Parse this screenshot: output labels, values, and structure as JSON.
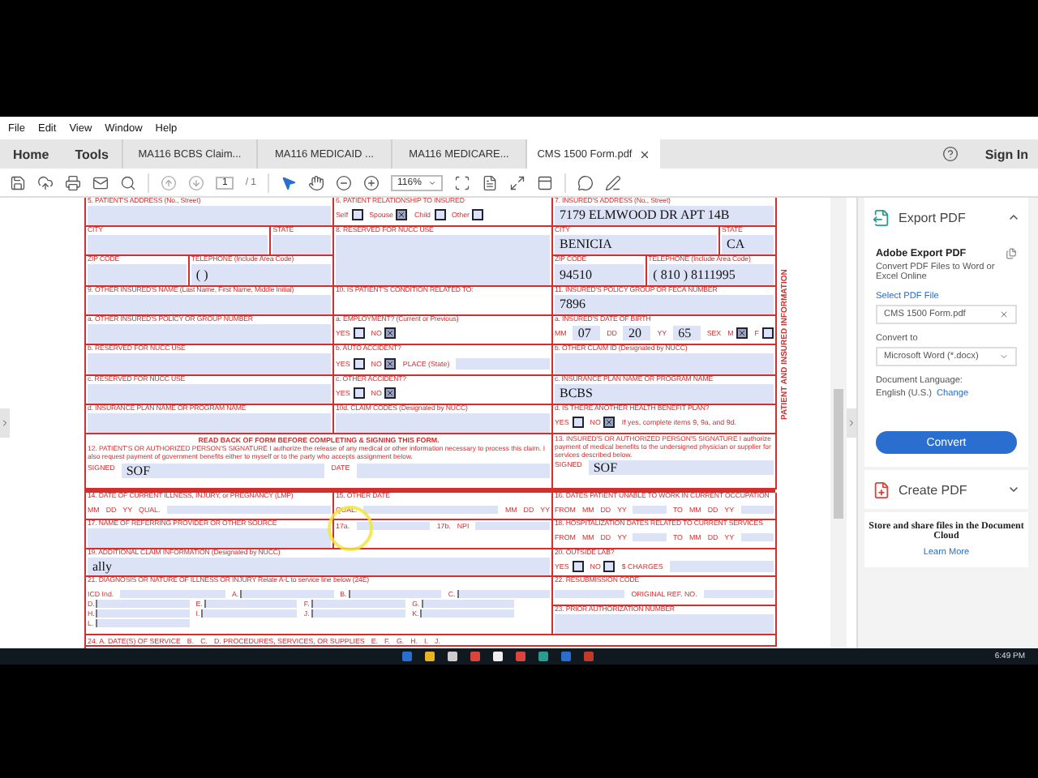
{
  "menu": [
    "File",
    "Edit",
    "View",
    "Window",
    "Help"
  ],
  "nav": [
    "Home",
    "Tools"
  ],
  "tabs": [
    {
      "label": "MA116 BCBS Claim...",
      "selected": false,
      "closable": false
    },
    {
      "label": "MA116 MEDICAID ...",
      "selected": false,
      "closable": false
    },
    {
      "label": "MA116 MEDICARE...",
      "selected": false,
      "closable": false
    },
    {
      "label": "CMS 1500 Form.pdf",
      "selected": true,
      "closable": true
    }
  ],
  "sign_in": "Sign In",
  "toolbar": {
    "page_current": "1",
    "page_total": "/ 1",
    "zoom": "116%"
  },
  "form": {
    "side_label": "PATIENT AND INSURED INFORMATION",
    "cells": [
      {
        "label": "5. PATIENT'S ADDRESS (No., Street)",
        "items": [
          {
            "kind": "input"
          }
        ]
      },
      {
        "label": "6. PATIENT RELATIONSHIP TO INSURED",
        "items": [
          {
            "kind": "check",
            "label": "Self",
            "checked": false
          },
          {
            "kind": "check",
            "label": "Spouse",
            "checked": true
          },
          {
            "kind": "check",
            "label": "Child",
            "checked": false
          },
          {
            "kind": "check",
            "label": "Other",
            "checked": false
          }
        ]
      },
      {
        "label": "7. INSURED'S ADDRESS (No., Street)",
        "items": [
          {
            "kind": "value",
            "text": "7179 ELMWOOD DR APT 14B"
          }
        ]
      },
      {
        "parts": [
          {
            "label": "CITY",
            "items": [
              {
                "kind": "input"
              }
            ]
          },
          {
            "label": "STATE",
            "items": [
              {
                "kind": "input"
              }
            ]
          }
        ]
      },
      {
        "label": "8. RESERVED FOR NUCC USE",
        "items": [
          {
            "kind": "input"
          }
        ]
      },
      {
        "parts": [
          {
            "label": "CITY",
            "items": [
              {
                "kind": "value",
                "text": "BENICIA"
              }
            ]
          },
          {
            "label": "STATE",
            "items": [
              {
                "kind": "value",
                "text": "CA"
              }
            ]
          }
        ]
      },
      {
        "parts": [
          {
            "label": "ZIP CODE",
            "items": [
              {
                "kind": "input"
              }
            ]
          },
          {
            "label": "TELEPHONE (Include Area Code)",
            "items": [
              {
                "kind": "value",
                "text": "(      )"
              }
            ]
          }
        ]
      },
      {
        "parts": [
          {
            "label": "ZIP CODE",
            "items": [
              {
                "kind": "value",
                "text": "94510"
              }
            ]
          },
          {
            "label": "TELEPHONE (Include Area Code)",
            "items": [
              {
                "kind": "value",
                "text": "( 810 ) 8111995"
              }
            ]
          }
        ]
      },
      {
        "label": "9. OTHER INSURED'S NAME (Last Name, First Name, Middle Initial)",
        "items": [
          {
            "kind": "input"
          }
        ]
      },
      {
        "label": "10. IS PATIENT'S CONDITION RELATED TO:"
      },
      {
        "label": "11. INSURED'S POLICY GROUP OR FECA NUMBER",
        "items": [
          {
            "kind": "value",
            "text": "7896"
          }
        ]
      },
      {
        "label": "a. OTHER INSURED'S POLICY OR GROUP NUMBER",
        "items": [
          {
            "kind": "input"
          }
        ]
      },
      {
        "label": "a. EMPLOYMENT? (Current or Previous)",
        "items": [
          {
            "kind": "check",
            "label": "YES",
            "checked": false
          },
          {
            "kind": "check",
            "label": "NO",
            "checked": true
          }
        ]
      },
      {
        "label": "a. INSURED'S DATE OF BIRTH",
        "items": [
          {
            "kind": "label",
            "text": "MM"
          },
          {
            "kind": "value",
            "text": "07"
          },
          {
            "kind": "label",
            "text": "DD"
          },
          {
            "kind": "value",
            "text": "20"
          },
          {
            "kind": "label",
            "text": "YY"
          },
          {
            "kind": "value",
            "text": "65"
          },
          {
            "kind": "label",
            "text": "SEX"
          },
          {
            "kind": "check",
            "label": "M",
            "checked": true
          },
          {
            "kind": "check",
            "label": "F",
            "checked": false
          }
        ]
      },
      {
        "label": "b. RESERVED FOR NUCC USE",
        "items": [
          {
            "kind": "input"
          }
        ]
      },
      {
        "label": "b. AUTO ACCIDENT?",
        "items": [
          {
            "kind": "check",
            "label": "YES",
            "checked": false
          },
          {
            "kind": "check",
            "label": "NO",
            "checked": true
          },
          {
            "kind": "label",
            "text": "PLACE (State)"
          },
          {
            "kind": "input"
          }
        ]
      },
      {
        "label": "b. OTHER CLAIM ID (Designated by NUCC)",
        "items": [
          {
            "kind": "input"
          }
        ]
      },
      {
        "label": "c. RESERVED FOR NUCC USE",
        "items": [
          {
            "kind": "input"
          }
        ]
      },
      {
        "label": "c. OTHER ACCIDENT?",
        "items": [
          {
            "kind": "check",
            "label": "YES",
            "checked": false
          },
          {
            "kind": "check",
            "label": "NO",
            "checked": true
          }
        ]
      },
      {
        "label": "c. INSURANCE PLAN NAME OR PROGRAM NAME",
        "items": [
          {
            "kind": "value",
            "text": "BCBS"
          }
        ]
      },
      {
        "label": "d. INSURANCE PLAN NAME OR PROGRAM NAME",
        "items": [
          {
            "kind": "input"
          }
        ]
      },
      {
        "label": "10d. CLAIM CODES (Designated by NUCC)",
        "items": [
          {
            "kind": "input"
          }
        ]
      },
      {
        "label": "d. IS THERE ANOTHER HEALTH BENEFIT PLAN?",
        "items": [
          {
            "kind": "check",
            "label": "YES",
            "checked": false
          },
          {
            "kind": "check",
            "label": "NO",
            "checked": true
          },
          {
            "kind": "label",
            "text": "If yes, complete items 9, 9a, and 9d."
          }
        ]
      },
      {
        "items": [
          {
            "kind": "heading",
            "text": "READ BACK OF FORM BEFORE COMPLETING & SIGNING THIS FORM."
          },
          {
            "kind": "note",
            "text": "12. PATIENT'S OR AUTHORIZED PERSON'S SIGNATURE I authorize the release of any medical or other information necessary to process this claim. I also request payment of government benefits either to myself or to the party who accepts assignment below."
          },
          {
            "kind": "label",
            "text": "SIGNED"
          },
          {
            "kind": "value",
            "text": "SOF"
          },
          {
            "kind": "label",
            "text": "DATE"
          },
          {
            "kind": "input"
          }
        ]
      },
      {
        "items": [
          {
            "kind": "note",
            "text": "13. INSURED'S OR AUTHORIZED PERSON'S SIGNATURE I authorize payment of medical benefits to the undersigned physician or supplier for services described below."
          },
          {
            "kind": "label",
            "text": "SIGNED"
          },
          {
            "kind": "value",
            "text": "SOF"
          }
        ]
      },
      {
        "label": "14. DATE OF CURRENT ILLNESS, INJURY, or PREGNANCY (LMP)",
        "items": [
          {
            "kind": "label",
            "text": "MM"
          },
          {
            "kind": "label",
            "text": "DD"
          },
          {
            "kind": "label",
            "text": "YY"
          },
          {
            "kind": "label",
            "text": "QUAL."
          },
          {
            "kind": "input"
          }
        ]
      },
      {
        "label": "15. OTHER DATE",
        "items": [
          {
            "kind": "label",
            "text": "QUAL."
          },
          {
            "kind": "input"
          },
          {
            "kind": "label",
            "text": "MM"
          },
          {
            "kind": "label",
            "text": "DD"
          },
          {
            "kind": "label",
            "text": "YY"
          }
        ]
      },
      {
        "label": "16. DATES PATIENT UNABLE TO WORK IN CURRENT OCCUPATION",
        "items": [
          {
            "kind": "label",
            "text": "FROM"
          },
          {
            "kind": "label",
            "text": "MM"
          },
          {
            "kind": "label",
            "text": "DD"
          },
          {
            "kind": "label",
            "text": "YY"
          },
          {
            "kind": "input"
          },
          {
            "kind": "label",
            "text": "TO"
          },
          {
            "kind": "label",
            "text": "MM"
          },
          {
            "kind": "label",
            "text": "DD"
          },
          {
            "kind": "label",
            "text": "YY"
          },
          {
            "kind": "input"
          }
        ]
      },
      {
        "label": "17. NAME OF REFERRING PROVIDER OR OTHER SOURCE",
        "items": [
          {
            "kind": "input"
          }
        ]
      },
      {
        "items": [
          {
            "kind": "label",
            "text": "17a."
          },
          {
            "kind": "input"
          },
          {
            "kind": "label",
            "text": "17b."
          },
          {
            "kind": "label",
            "text": "NPI"
          },
          {
            "kind": "input"
          }
        ]
      },
      {
        "label": "18. HOSPITALIZATION DATES RELATED TO CURRENT SERVICES",
        "items": [
          {
            "kind": "label",
            "text": "FROM"
          },
          {
            "kind": "label",
            "text": "MM"
          },
          {
            "kind": "label",
            "text": "DD"
          },
          {
            "kind": "label",
            "text": "YY"
          },
          {
            "kind": "input"
          },
          {
            "kind": "label",
            "text": "TO"
          },
          {
            "kind": "label",
            "text": "MM"
          },
          {
            "kind": "label",
            "text": "DD"
          },
          {
            "kind": "label",
            "text": "YY"
          },
          {
            "kind": "input"
          }
        ]
      },
      {
        "label": "19. ADDITIONAL CLAIM INFORMATION (Designated by NUCC)",
        "items": [
          {
            "kind": "value",
            "text": "ally"
          }
        ]
      },
      {
        "label": "20. OUTSIDE LAB?",
        "items": [
          {
            "kind": "check",
            "label": "YES",
            "checked": false
          },
          {
            "kind": "check",
            "label": "NO",
            "checked": false
          },
          {
            "kind": "label",
            "text": "$ CHARGES"
          },
          {
            "kind": "input"
          }
        ]
      },
      {
        "label": "21. DIAGNOSIS OR NATURE OF ILLNESS OR INJURY  Relate A-L to service line below (24E)",
        "items": [
          {
            "kind": "label",
            "text": "ICD Ind."
          },
          {
            "kind": "input"
          },
          {
            "kind": "line",
            "text": "A."
          },
          {
            "kind": "line",
            "text": "B."
          },
          {
            "kind": "line",
            "text": "C."
          },
          {
            "kind": "line",
            "text": "D."
          },
          {
            "kind": "line",
            "text": "E."
          },
          {
            "kind": "line",
            "text": "F."
          },
          {
            "kind": "line",
            "text": "G."
          },
          {
            "kind": "line",
            "text": "H."
          },
          {
            "kind": "line",
            "text": "I."
          },
          {
            "kind": "line",
            "text": "J."
          },
          {
            "kind": "line",
            "text": "K."
          },
          {
            "kind": "line",
            "text": "L."
          }
        ]
      },
      {
        "label": "22. RESUBMISSION CODE",
        "items": [
          {
            "kind": "input"
          },
          {
            "kind": "label",
            "text": "ORIGINAL REF. NO."
          },
          {
            "kind": "input"
          }
        ]
      },
      {
        "label": "23. PRIOR AUTHORIZATION NUMBER",
        "items": [
          {
            "kind": "input"
          }
        ]
      },
      {
        "items": [
          {
            "kind": "label",
            "text": "24. A. DATE(S) OF SERVICE"
          },
          {
            "kind": "label",
            "text": "B."
          },
          {
            "kind": "label",
            "text": "C."
          },
          {
            "kind": "label",
            "text": "D. PROCEDURES, SERVICES, OR SUPPLIES"
          },
          {
            "kind": "label",
            "text": "E."
          },
          {
            "kind": "label",
            "text": "F."
          },
          {
            "kind": "label",
            "text": "G."
          },
          {
            "kind": "label",
            "text": "H."
          },
          {
            "kind": "label",
            "text": "I."
          },
          {
            "kind": "label",
            "text": "J."
          }
        ]
      }
    ]
  },
  "export_panel": {
    "title": "Export PDF",
    "expanded": true,
    "heading": "Adobe Export PDF",
    "description": "Convert PDF Files to Word or Excel Online",
    "file_label": "Select PDF File",
    "file_name": "CMS 1500 Form.pdf",
    "convert_label": "Convert to",
    "format": "Microsoft Word (*.docx)",
    "language_label": "Document Language:",
    "language": "English (U.S.)",
    "change_link": "Change",
    "button": "Convert"
  },
  "create_panel": {
    "title": "Create PDF",
    "expanded": false
  },
  "cloud_promo": {
    "text": "Store and share files in the Document Cloud",
    "link": "Learn More"
  },
  "taskbar": {
    "time": "6:49 PM"
  }
}
